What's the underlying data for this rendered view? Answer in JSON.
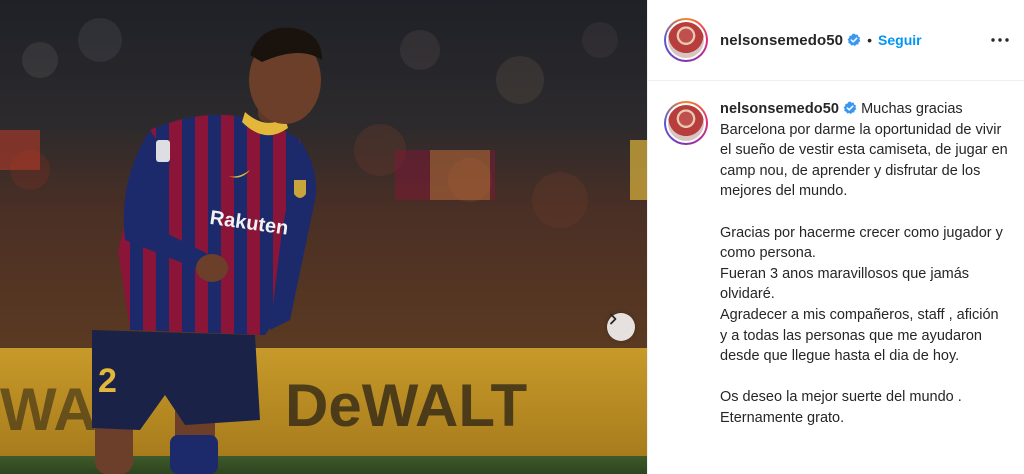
{
  "post": {
    "image_alt": "Futbolista con la camiseta del Barcelona en el estadio",
    "image_texts": {
      "sponsor": "Rakuten",
      "board": "DeWALT",
      "number": "2"
    }
  },
  "header": {
    "username": "nelsonsemedo50",
    "verified_icon": "verified-badge-icon",
    "separator": "•",
    "follow_label": "Seguir",
    "more_icon": "more-horizontal-icon"
  },
  "caption": {
    "username": "nelsonsemedo50",
    "paragraphs": [
      "Muchas gracias Barcelona por darme la oportunidad de vivir el sueño de vestir esta camiseta, de jugar en camp nou, de aprender y disfrutar de los mejores del mundo.",
      "Gracias por hacerme crecer como jugador y como persona.",
      "Fueran 3 anos maravillosos que jamás olvidaré.",
      "Agradecer a mis compañeros, staff , afición y a todas las personas que me ayudaron desde que llegue hasta el dia de hoy.",
      "Os deseo la mejor suerte del mundo .",
      "Eternamente grato."
    ]
  },
  "colors": {
    "link_blue": "#0095f6",
    "text": "#262626",
    "divider": "#efefef",
    "verified": "#3897f0"
  }
}
